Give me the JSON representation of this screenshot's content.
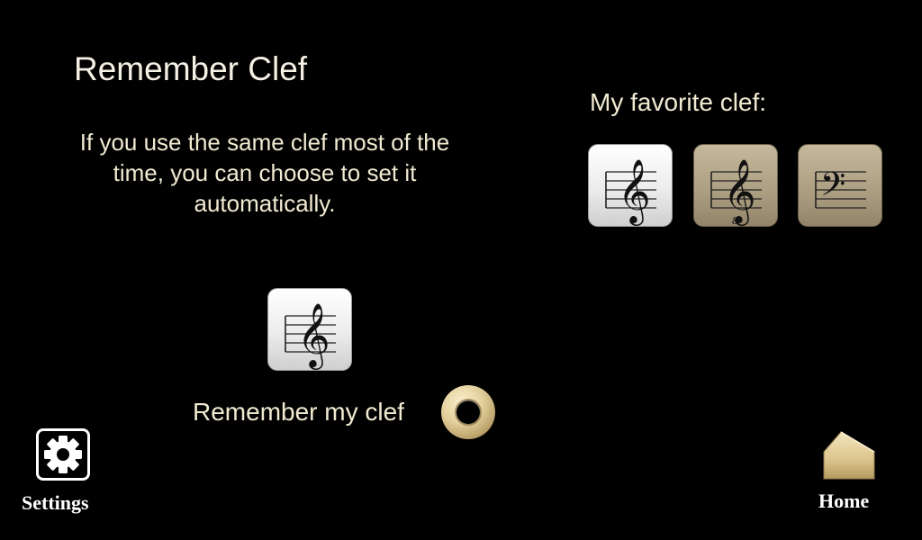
{
  "page": {
    "title": "Remember Clef",
    "description": "If you use the same clef most of the time, you can choose to set it automatically."
  },
  "favorite": {
    "label": "My favorite clef:",
    "options": [
      {
        "clef": "treble",
        "state": "selected",
        "icon": "treble-clef-icon"
      },
      {
        "clef": "treble-8",
        "state": "unselected",
        "icon": "treble-clef-8vb-icon"
      },
      {
        "clef": "bass",
        "state": "unselected",
        "icon": "bass-clef-icon"
      }
    ]
  },
  "current_clef": {
    "clef": "treble",
    "icon": "treble-clef-icon"
  },
  "remember": {
    "label": "Remember my clef",
    "enabled": false
  },
  "nav": {
    "settings_label": "Settings",
    "home_label": "Home",
    "settings_icon": "gear-icon",
    "home_icon": "home-icon"
  },
  "colors": {
    "background": "#000000",
    "text": "#f1ead2",
    "selected_tile": "#f0f0f0",
    "unselected_tile": "#ab9d80",
    "toggle": "#e3cf9c"
  }
}
